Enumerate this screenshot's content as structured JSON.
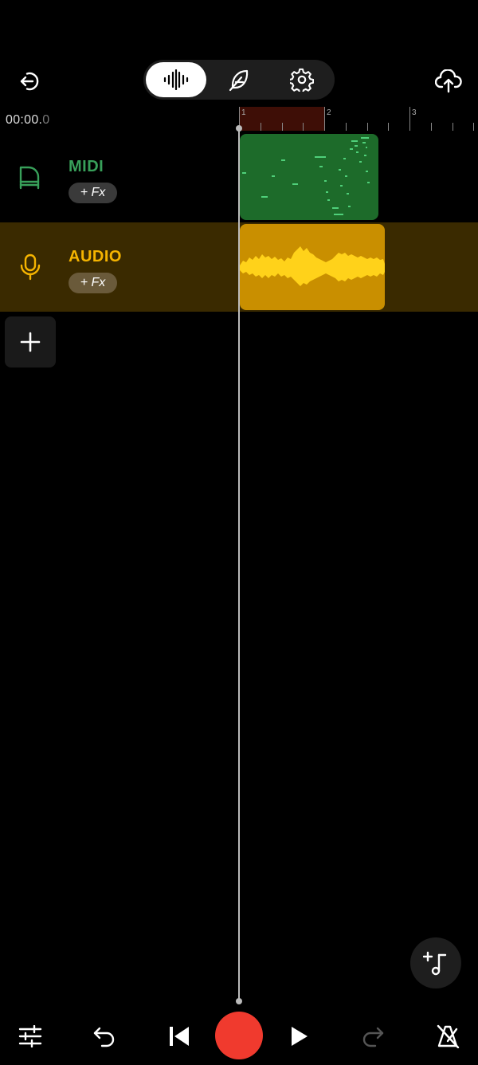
{
  "header": {
    "exit_icon": "exit-icon",
    "modes": [
      {
        "icon": "waveform-icon",
        "active": true
      },
      {
        "icon": "feather-icon",
        "active": false
      },
      {
        "icon": "gear-icon",
        "active": false
      }
    ],
    "upload_icon": "cloud-upload-icon"
  },
  "timeline": {
    "time_main": "00:00.",
    "time_fraction": "0",
    "bars": [
      "1",
      "2",
      "3"
    ]
  },
  "tracks": [
    {
      "name": "MIDI",
      "fx_label": "+ Fx",
      "icon": "piano-icon",
      "color": "#38a05a"
    },
    {
      "name": "AUDIO",
      "fx_label": "+ Fx",
      "icon": "microphone-icon",
      "color": "#f5b400"
    }
  ],
  "colors": {
    "midi_clip": "#1d6b2a",
    "audio_clip": "#c98f00",
    "audio_track_bg": "#3a2a00",
    "record": "#f03a2e",
    "loop_region": "#3e0e06"
  },
  "controls": {
    "add_track_icon": "plus-icon",
    "add_note_icon": "add-note-icon",
    "bottom": [
      "mixer-icon",
      "undo-icon",
      "skip-back-icon",
      "record-icon",
      "play-icon",
      "redo-icon",
      "metronome-icon"
    ]
  }
}
